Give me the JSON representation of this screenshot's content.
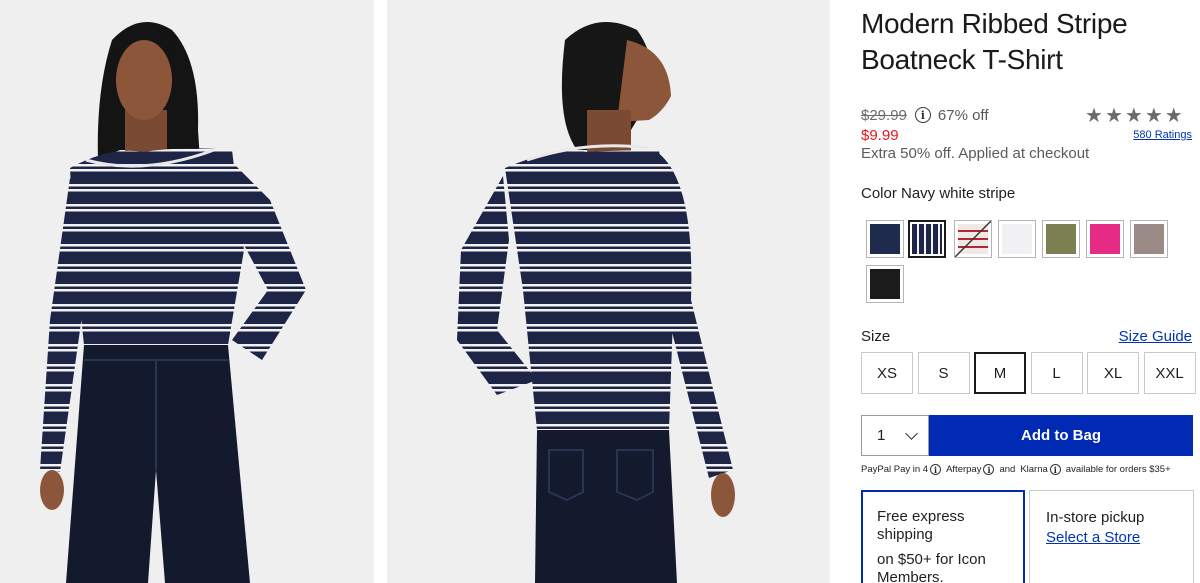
{
  "gallery": {
    "images": [
      {
        "name": "front-view"
      },
      {
        "name": "back-view"
      }
    ]
  },
  "product": {
    "title": "Modern Ribbed Stripe Boatneck T-Shirt",
    "original_price": "$29.99",
    "discount": "67% off",
    "sale_price": "$9.99",
    "promo_note": "Extra 50% off. Applied at checkout",
    "rating_stars": 5,
    "ratings_link": "580 Ratings"
  },
  "color": {
    "label": "Color Navy white stripe",
    "swatches": [
      {
        "name": "navy",
        "color": "#1f2b4d",
        "selected": false
      },
      {
        "name": "navy-white-stripe",
        "color": "#1d2448",
        "selected": true
      },
      {
        "name": "red-white-stripe",
        "color": "#e9e4de",
        "selected": false,
        "unavailable": true
      },
      {
        "name": "white",
        "color": "#f1f1f4",
        "selected": false
      },
      {
        "name": "olive",
        "color": "#7c7f52",
        "selected": false
      },
      {
        "name": "pink",
        "color": "#e52b86",
        "selected": false
      },
      {
        "name": "taupe",
        "color": "#9b8b86",
        "selected": false
      },
      {
        "name": "black",
        "color": "#1b1b1b",
        "selected": false
      }
    ]
  },
  "size": {
    "label": "Size",
    "guide": "Size Guide",
    "options": [
      "XS",
      "S",
      "M",
      "L",
      "XL",
      "XXL"
    ],
    "selected": "M"
  },
  "purchase": {
    "quantity": "1",
    "add_to_bag": "Add to Bag"
  },
  "payment": {
    "paypal": "PayPal Pay in 4",
    "afterpay": "Afterpay",
    "and": "and",
    "klarna": "Klarna",
    "suffix": "available for orders $35+"
  },
  "shipping": {
    "free_line1": "Free express shipping",
    "free_line2": "on $50+ for Icon Members.",
    "pickup_title": "In-store pickup",
    "pickup_link": "Select a Store"
  },
  "colors": {
    "accent": "#0029b4",
    "sale": "#e8141b",
    "link": "#0033b4"
  }
}
